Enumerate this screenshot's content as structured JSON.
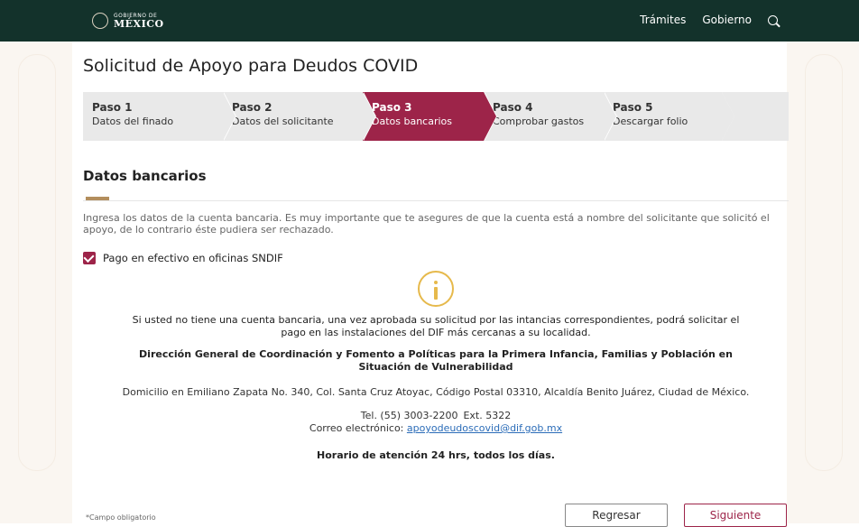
{
  "header": {
    "logo_small": "GOBIERNO DE",
    "logo_big": "MÉXICO",
    "nav": [
      "Trámites",
      "Gobierno"
    ],
    "search_icon": "search-icon"
  },
  "page": {
    "title": "Solicitud de Apoyo para Deudos COVID"
  },
  "steps": [
    {
      "num": "Paso 1",
      "label": "Datos del finado",
      "active": false
    },
    {
      "num": "Paso 2",
      "label": "Datos del solicitante",
      "active": false
    },
    {
      "num": "Paso 3",
      "label": "Datos bancarios",
      "active": true
    },
    {
      "num": "Paso 4",
      "label": "Comprobar gastos",
      "active": false
    },
    {
      "num": "Paso 5",
      "label": "Descargar folio",
      "active": false
    }
  ],
  "section": {
    "title": "Datos bancarios",
    "description": "Ingresa los datos de la cuenta bancaria. Es muy importante que te asegures de que la cuenta está a nombre del solicitante que solicitó el apoyo, de lo contrario éste pudiera ser rechazado.",
    "checkbox_label": "Pago en efectivo en oficinas SNDIF",
    "checkbox_checked": true
  },
  "info": {
    "icon": "info-icon",
    "message": "Si usted no tiene una cuenta bancaria, una vez aprobada su solicitud por las intancias correspondientes, podrá solicitar el pago en las instalaciones del DIF más cercanas a su localidad.",
    "direccion": "Dirección General de Coordinación y Fomento a Políticas para la Primera Infancia, Familias y Población en Situación de Vulnerabilidad",
    "domicilio": "Domicilio en Emiliano Zapata No. 340, Col. Santa Cruz Atoyac, Código Postal 03310, Alcaldía Benito Juárez, Ciudad de México.",
    "tel": "Tel. (55) 3003-2200",
    "ext": "Ext. 5322",
    "correo_label": "Correo electrónico:",
    "correo": "apoyodeudoscovid@dif.gob.mx",
    "horario": "Horario de atención 24 hrs, todos los días."
  },
  "footer": {
    "required_note": "*Campo obligatorio",
    "back_label": "Regresar",
    "next_label": "Siguiente"
  },
  "colors": {
    "header_bg": "#13322b",
    "accent": "#9d2449",
    "gold": "#b38e5d",
    "info_yellow": "#e6b94b"
  }
}
